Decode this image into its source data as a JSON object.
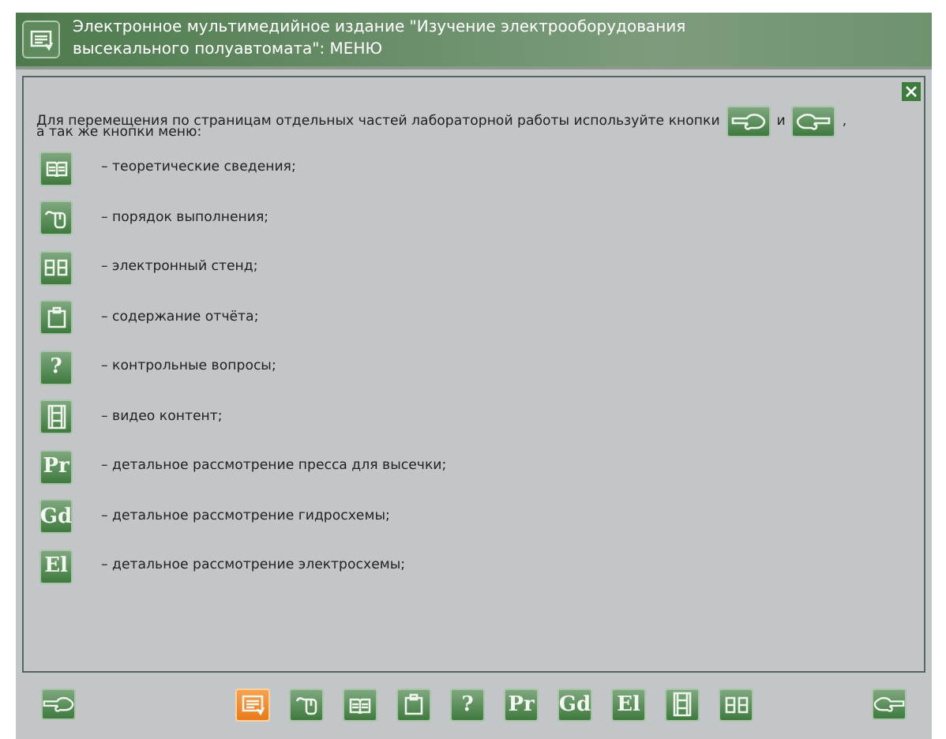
{
  "header": {
    "title": "Электронное мультимедийное издание \"Изучение электрооборудования высекального полуавтомата\": МЕНЮ"
  },
  "intro": {
    "before": "Для перемещения по страницам отдельных частей лабораторной работы используйте кнопки",
    "between": "и",
    "after": ",",
    "line2": "а так же кнопки меню:"
  },
  "legend": [
    {
      "kind": "book",
      "text": "– теоретические сведения;"
    },
    {
      "kind": "mouse",
      "text": "– порядок выполнения;"
    },
    {
      "kind": "stand",
      "text": "– электронный стенд;"
    },
    {
      "kind": "clipboard",
      "text": "– содержание отчёта;"
    },
    {
      "kind": "letter",
      "glyph": "?",
      "text": "– контрольные вопросы;"
    },
    {
      "kind": "film",
      "text": "– видео контент;"
    },
    {
      "kind": "letter",
      "glyph": "Pr",
      "text": "– детальное рассмотрение пресса для высечки;"
    },
    {
      "kind": "letter",
      "glyph": "Gd",
      "text": "– детальное рассмотрение гидросхемы;"
    },
    {
      "kind": "letter",
      "glyph": "El",
      "text": "– детальное рассмотрение электросхемы;"
    }
  ],
  "toolbar": [
    {
      "kind": "menu",
      "selected": true
    },
    {
      "kind": "mouse",
      "selected": false
    },
    {
      "kind": "book",
      "selected": false
    },
    {
      "kind": "clipboard",
      "selected": false
    },
    {
      "kind": "letter",
      "glyph": "?",
      "selected": false
    },
    {
      "kind": "letter",
      "glyph": "Pr",
      "selected": false
    },
    {
      "kind": "letter",
      "glyph": "Gd",
      "selected": false
    },
    {
      "kind": "letter",
      "glyph": "El",
      "selected": false
    },
    {
      "kind": "film",
      "selected": false
    },
    {
      "kind": "stand",
      "selected": false
    }
  ]
}
